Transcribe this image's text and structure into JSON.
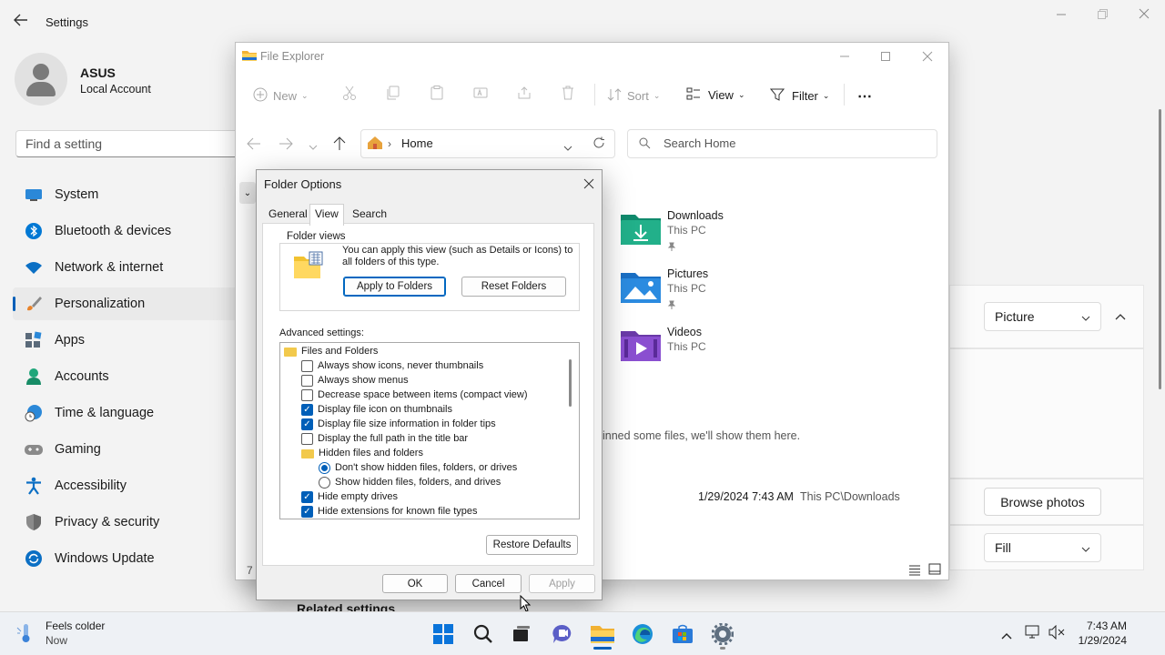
{
  "settings": {
    "title": "Settings",
    "user": {
      "name": "ASUS",
      "type": "Local Account"
    },
    "find_placeholder": "Find a setting",
    "nav": [
      {
        "label": "System"
      },
      {
        "label": "Bluetooth & devices"
      },
      {
        "label": "Network & internet"
      },
      {
        "label": "Personalization"
      },
      {
        "label": "Apps"
      },
      {
        "label": "Accounts"
      },
      {
        "label": "Time & language"
      },
      {
        "label": "Gaming"
      },
      {
        "label": "Accessibility"
      },
      {
        "label": "Privacy & security"
      },
      {
        "label": "Windows Update"
      }
    ],
    "background_type": "Picture",
    "browse_label": "Browse photos",
    "fit_value": "Fill",
    "related_settings": "Related settings",
    "colors": {
      "accent": "#005fb8"
    }
  },
  "explorer": {
    "title": "File Explorer",
    "toolbar": {
      "new": "New",
      "sort": "Sort",
      "view": "View",
      "filter": "Filter"
    },
    "address": "Home",
    "search_placeholder": "Search Home",
    "quick_access": [
      {
        "name": "Downloads",
        "location": "This PC"
      },
      {
        "name": "Pictures",
        "location": "This PC"
      },
      {
        "name": "Videos",
        "location": "This PC"
      }
    ],
    "pinned_msg": "inned some files, we'll show them here.",
    "recent": {
      "date": "1/29/2024 7:43 AM",
      "path": "This PC\\Downloads"
    },
    "status_fragment": "7"
  },
  "dialog": {
    "title": "Folder Options",
    "tabs": [
      "General",
      "View",
      "Search"
    ],
    "folder_views": {
      "label": "Folder views",
      "text": "You can apply this view (such as Details or Icons) to all folders of this type.",
      "apply_button": "Apply to Folders",
      "reset_button": "Reset Folders"
    },
    "advanced_label": "Advanced settings:",
    "items": [
      {
        "kind": "folder",
        "label": "Files and Folders",
        "level": 0
      },
      {
        "kind": "checkbox",
        "label": "Always show icons, never thumbnails",
        "checked": false,
        "level": 1
      },
      {
        "kind": "checkbox",
        "label": "Always show menus",
        "checked": false,
        "level": 1
      },
      {
        "kind": "checkbox",
        "label": "Decrease space between items (compact view)",
        "checked": false,
        "level": 1
      },
      {
        "kind": "checkbox",
        "label": "Display file icon on thumbnails",
        "checked": true,
        "level": 1
      },
      {
        "kind": "checkbox",
        "label": "Display file size information in folder tips",
        "checked": true,
        "level": 1
      },
      {
        "kind": "checkbox",
        "label": "Display the full path in the title bar",
        "checked": false,
        "level": 1
      },
      {
        "kind": "folder",
        "label": "Hidden files and folders",
        "level": 1
      },
      {
        "kind": "radio",
        "label": "Don't show hidden files, folders, or drives",
        "checked": true,
        "level": 2
      },
      {
        "kind": "radio",
        "label": "Show hidden files, folders, and drives",
        "checked": false,
        "level": 2
      },
      {
        "kind": "checkbox",
        "label": "Hide empty drives",
        "checked": true,
        "level": 1
      },
      {
        "kind": "checkbox",
        "label": "Hide extensions for known file types",
        "checked": true,
        "level": 1
      }
    ],
    "restore_button": "Restore Defaults",
    "ok": "OK",
    "cancel": "Cancel",
    "apply": "Apply"
  },
  "taskbar": {
    "weather": {
      "line1": "Feels colder",
      "line2": "Now"
    },
    "time": "7:43 AM",
    "date": "1/29/2024"
  }
}
